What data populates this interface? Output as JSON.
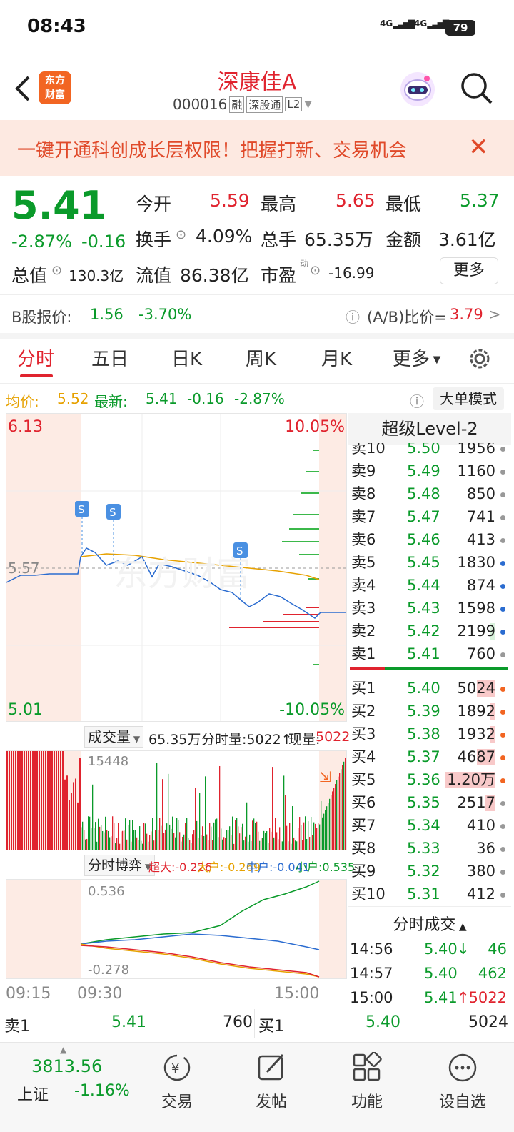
{
  "status": {
    "time": "08:43",
    "battery": "79",
    "net1": "4G",
    "net2": "4G"
  },
  "header": {
    "title": "深康佳A",
    "code": "000016",
    "tags": [
      "融",
      "深股通",
      "L2"
    ],
    "logo": "东方\n财富"
  },
  "banner": {
    "text": "一键开通科创成长层权限！把握打新、交易机会"
  },
  "quote": {
    "price": "5.41",
    "pct": "-2.87%",
    "chg": "-0.16",
    "open_label": "今开",
    "open": "5.59",
    "high_label": "最高",
    "high": "5.65",
    "low_label": "最低",
    "low": "5.37",
    "turnover_label": "换手",
    "turnover": "4.09%",
    "volume_label": "总手",
    "volume": "65.35万",
    "amount_label": "金额",
    "amount": "3.61亿",
    "mcap_label": "总值",
    "mcap": "130.3亿",
    "float_label": "流值",
    "float": "86.38亿",
    "pe_label": "市盈",
    "pe_sup": "动",
    "pe": "-16.99",
    "more": "更多",
    "bshare_label": "B股报价:",
    "bshare_price": "1.56",
    "bshare_pct": "-3.70%",
    "ab_label": "(A/B)比价=",
    "ab_value": "3.79"
  },
  "tabs": [
    "分时",
    "五日",
    "日K",
    "周K",
    "月K",
    "更多"
  ],
  "info_line": {
    "avg_label": "均价:",
    "avg": "5.52",
    "last_label": "最新:",
    "last": "5.41",
    "chg": "-0.16",
    "pct": "-2.87%",
    "mode": "大单模式"
  },
  "chart": {
    "top_price": "6.13",
    "top_pct": "10.05%",
    "bottom_price": "5.01",
    "bottom_pct": "-10.05%",
    "ref": "5.57",
    "watermark": "东方财富",
    "vol_label": "成交量",
    "vol_total": "65.35万",
    "vol_min": "分时量:5022↑",
    "vol_now_label": "现量:",
    "vol_now": "5022",
    "vol_max": "15448",
    "game_label": "分时博弈",
    "game_values": {
      "super": "超大:-0.226",
      "large": "大户:-0.269",
      "mid": "中户:-0.041",
      "small": "小户:0.535"
    },
    "game_top": "0.536",
    "game_bottom": "-0.278",
    "times": [
      "09:15",
      "09:30",
      "15:00"
    ]
  },
  "orderbook": {
    "title": "超级Level-2",
    "sells": [
      {
        "n": "卖10",
        "p": "5.50",
        "v": "1956"
      },
      {
        "n": "卖9",
        "p": "5.49",
        "v": "1160"
      },
      {
        "n": "卖8",
        "p": "5.48",
        "v": "850"
      },
      {
        "n": "卖7",
        "p": "5.47",
        "v": "741"
      },
      {
        "n": "卖6",
        "p": "5.46",
        "v": "413"
      },
      {
        "n": "卖5",
        "p": "5.45",
        "v": "1830"
      },
      {
        "n": "卖4",
        "p": "5.44",
        "v": "874"
      },
      {
        "n": "卖3",
        "p": "5.43",
        "v": "1598"
      },
      {
        "n": "卖2",
        "p": "5.42",
        "v": "2199"
      },
      {
        "n": "卖1",
        "p": "5.41",
        "v": "760"
      }
    ],
    "buys": [
      {
        "n": "买1",
        "p": "5.40",
        "v": "5024"
      },
      {
        "n": "买2",
        "p": "5.39",
        "v": "1892"
      },
      {
        "n": "买3",
        "p": "5.38",
        "v": "1932"
      },
      {
        "n": "买4",
        "p": "5.37",
        "v": "4687"
      },
      {
        "n": "买5",
        "p": "5.36",
        "v": "1.20万"
      },
      {
        "n": "买6",
        "p": "5.35",
        "v": "2517"
      },
      {
        "n": "买7",
        "p": "5.34",
        "v": "410"
      },
      {
        "n": "买8",
        "p": "5.33",
        "v": "36"
      },
      {
        "n": "买9",
        "p": "5.32",
        "v": "380"
      },
      {
        "n": "买10",
        "p": "5.31",
        "v": "412"
      }
    ],
    "ticks_title": "分时成交",
    "ticks": [
      {
        "t": "14:56",
        "p": "5.40",
        "a": "↓",
        "v": "46"
      },
      {
        "t": "14:57",
        "p": "5.40",
        "a": "",
        "v": "462"
      },
      {
        "t": "15:00",
        "p": "5.41",
        "a": "↑",
        "v": "5022"
      }
    ]
  },
  "bottom_quote": {
    "sell_label": "卖1",
    "sell_price": "5.41",
    "sell_vol": "760",
    "buy_label": "买1",
    "buy_price": "5.40",
    "buy_vol": "5024"
  },
  "nav": {
    "index_value": "3813.56",
    "index_name": "上证",
    "index_pct": "-1.16%",
    "items": [
      "交易",
      "发帖",
      "功能",
      "设自选"
    ]
  }
}
